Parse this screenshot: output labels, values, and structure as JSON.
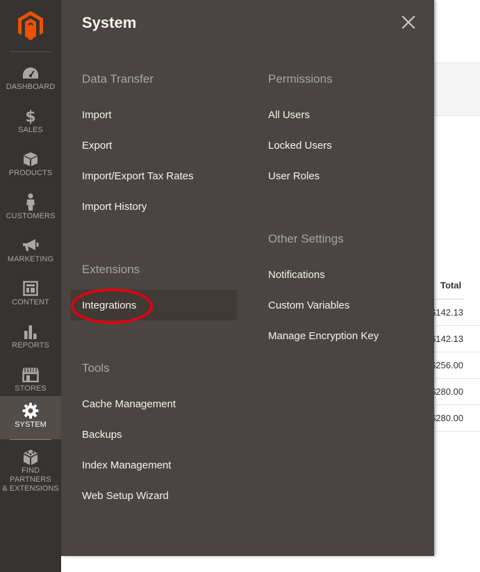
{
  "nav": {
    "items": [
      {
        "label": "DASHBOARD",
        "icon": "dashboard-icon"
      },
      {
        "label": "SALES",
        "icon": "dollar-icon"
      },
      {
        "label": "PRODUCTS",
        "icon": "box-icon"
      },
      {
        "label": "CUSTOMERS",
        "icon": "person-icon"
      },
      {
        "label": "MARKETING",
        "icon": "megaphone-icon"
      },
      {
        "label": "CONTENT",
        "icon": "layout-icon"
      },
      {
        "label": "REPORTS",
        "icon": "bar-chart-icon"
      },
      {
        "label": "STORES",
        "icon": "storefront-icon"
      },
      {
        "label": "SYSTEM",
        "icon": "gear-icon"
      },
      {
        "label_line1": "FIND PARTNERS",
        "label_line2": "& EXTENSIONS",
        "icon": "blocks-icon"
      }
    ]
  },
  "panel": {
    "title": "System",
    "sections": {
      "data_transfer": {
        "title": "Data Transfer",
        "links": [
          "Import",
          "Export",
          "Import/Export Tax Rates",
          "Import History"
        ]
      },
      "extensions": {
        "title": "Extensions",
        "links": [
          "Integrations"
        ]
      },
      "tools": {
        "title": "Tools",
        "links": [
          "Cache Management",
          "Backups",
          "Index Management",
          "Web Setup Wizard"
        ]
      },
      "permissions": {
        "title": "Permissions",
        "links": [
          "All Users",
          "Locked Users",
          "User Roles"
        ]
      },
      "other_settings": {
        "title": "Other Settings",
        "links": [
          "Notifications",
          "Custom Variables",
          "Manage Encryption Key"
        ]
      }
    }
  },
  "background": {
    "total_header": "Total",
    "rows": [
      "$142.13",
      "$142.13",
      "$256.00",
      "$280.00",
      "$280.00"
    ]
  },
  "colors": {
    "nav_bg": "#373330",
    "panel_bg": "#4a4542",
    "accent_orange": "#eb5202",
    "annotation_red": "#e4000f"
  }
}
